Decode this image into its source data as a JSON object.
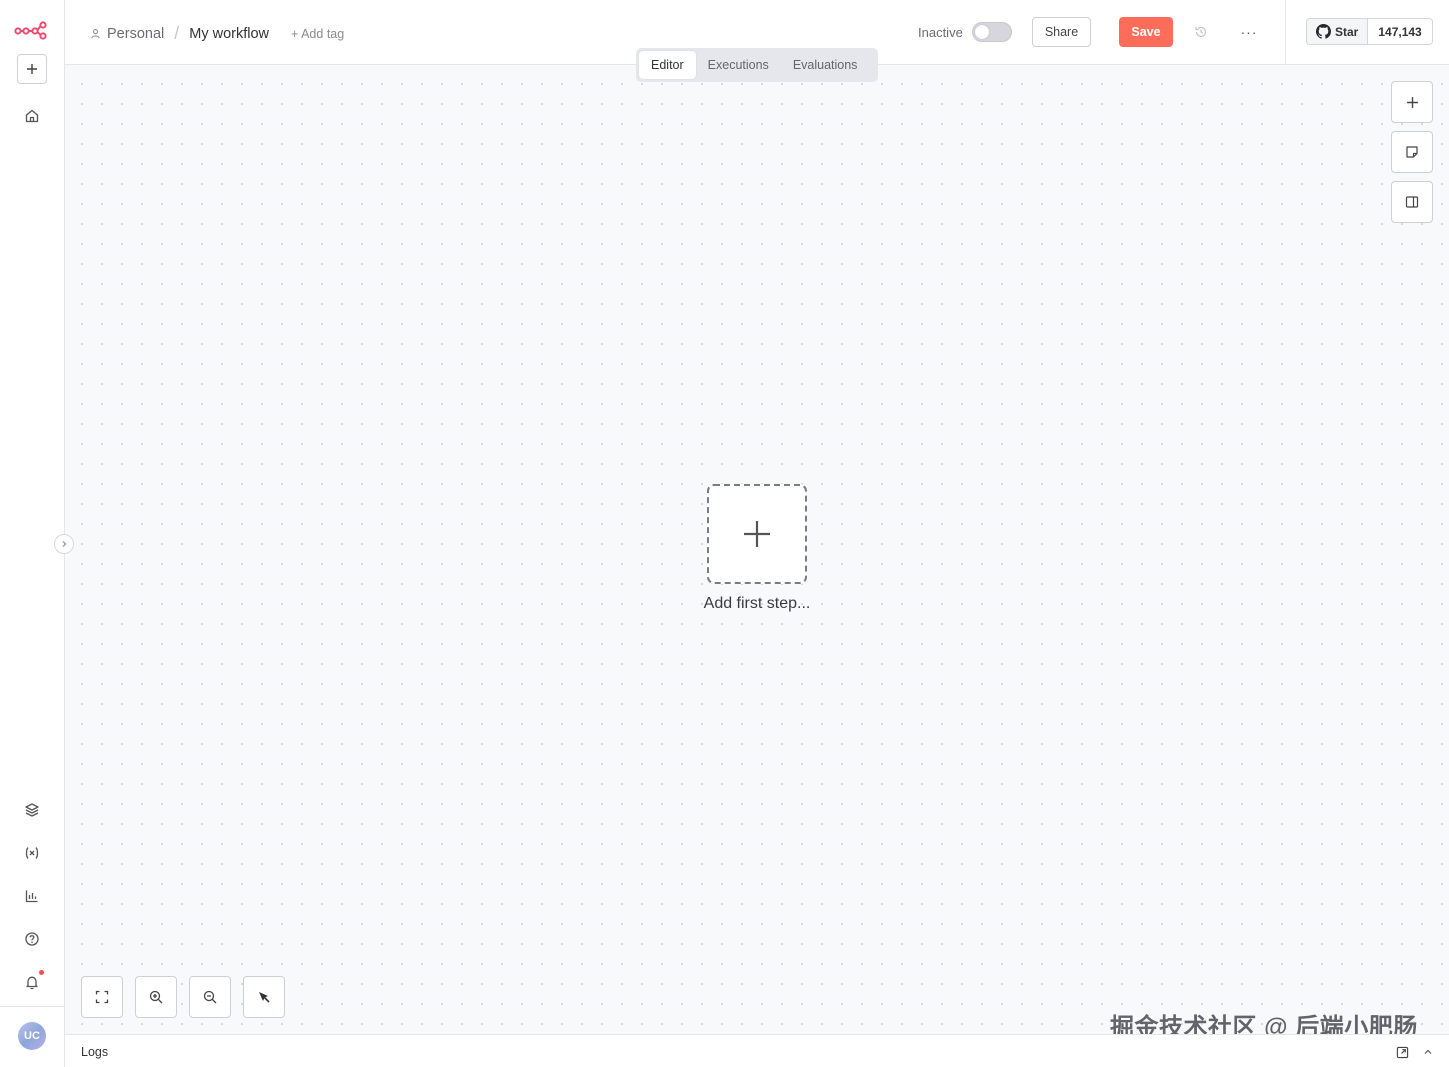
{
  "app": {
    "brand_color": "#ff6d5a",
    "logo_color": "#ea4b71"
  },
  "sidebar": {
    "add_button_icon": "plus-icon",
    "home_icon": "home-icon",
    "bottom_icons": [
      "templates-icon",
      "variables-icon",
      "insights-icon",
      "help-icon",
      "notifications-icon"
    ],
    "avatar_initials": "UC"
  },
  "header": {
    "breadcrumb_project": "Personal",
    "breadcrumb_separator": "/",
    "workflow_name": "My workflow",
    "add_tag": "+ Add tag",
    "status_label": "Inactive",
    "share_label": "Share",
    "save_label": "Save",
    "more_label": "···",
    "github_star_label": "Star",
    "github_star_count": "147,143"
  },
  "tabs": [
    {
      "label": "Editor",
      "active": true
    },
    {
      "label": "Executions",
      "active": false
    },
    {
      "label": "Evaluations",
      "active": false
    }
  ],
  "canvas": {
    "add_first_step_label": "Add first step...",
    "watermark": "掘金技术社区 @ 后端小肥肠"
  },
  "logs": {
    "label": "Logs"
  }
}
